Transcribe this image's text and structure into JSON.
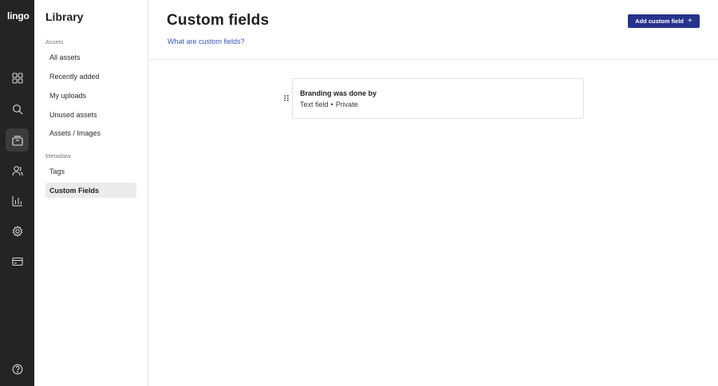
{
  "app": {
    "logo_text": "lingo"
  },
  "rail": {
    "items": [
      {
        "name": "dashboard",
        "icon": "grid-icon",
        "active": false
      },
      {
        "name": "search",
        "icon": "search-icon",
        "active": false
      },
      {
        "name": "library",
        "icon": "library-icon",
        "active": true
      },
      {
        "name": "users",
        "icon": "users-icon",
        "active": false
      },
      {
        "name": "analytics",
        "icon": "bar-chart-icon",
        "active": false
      },
      {
        "name": "settings",
        "icon": "gear-icon",
        "active": false
      },
      {
        "name": "billing",
        "icon": "card-icon",
        "active": false
      },
      {
        "name": "help",
        "icon": "help-icon",
        "active": false
      }
    ]
  },
  "panel": {
    "title": "Library",
    "assets_section_label": "Assets",
    "assets_items": [
      {
        "label": "All assets"
      },
      {
        "label": "Recently added"
      },
      {
        "label": "My uploads"
      },
      {
        "label": "Unused assets"
      },
      {
        "label": "Assets / Images"
      }
    ],
    "metadata_section_label": "Metadata",
    "metadata_items": [
      {
        "label": "Tags"
      },
      {
        "label": "Custom Fields",
        "selected": true
      }
    ]
  },
  "main": {
    "title": "Custom fields",
    "help_link": "What are custom fields?",
    "add_button_label": "Add custom field",
    "fields": [
      {
        "name": "Branding was done by",
        "type": "Text field",
        "separator": "•",
        "visibility": "Private"
      }
    ]
  },
  "colors": {
    "rail_bg": "#242424",
    "accent_button": "#26338c",
    "link": "#3a55b8",
    "selected_item_bg": "#ebebeb"
  }
}
